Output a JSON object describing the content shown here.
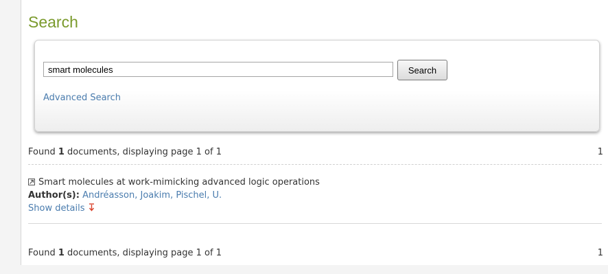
{
  "page": {
    "title": "Search"
  },
  "search": {
    "query": "smart molecules",
    "button_label": "Search",
    "advanced_label": "Advanced Search"
  },
  "summary": {
    "found_prefix": "Found ",
    "count": "1",
    "found_suffix": " documents, displaying page 1 of 1",
    "page_link": "1"
  },
  "results": [
    {
      "title": "Smart molecules at work-mimicking advanced logic operations",
      "authors_label": "Author(s):",
      "authors": "Andréasson, Joakim, Pischel, U.",
      "details_label": "Show details",
      "icon": "external-link-icon",
      "details_icon": "arrow-down-icon"
    }
  ],
  "colors": {
    "title_green": "#7a9a2c",
    "link_blue": "#4a7cae",
    "arrow_red": "#d9412b"
  }
}
